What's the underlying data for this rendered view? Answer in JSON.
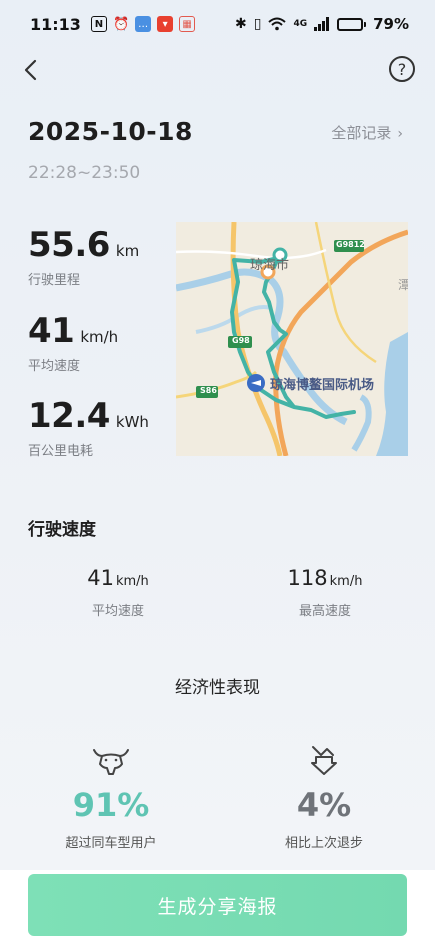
{
  "status_bar": {
    "time": "11:13",
    "network": "4G",
    "battery_percent": "79%",
    "battery_level": 0.79,
    "icons": [
      "nfc-icon",
      "alarm-icon",
      "chat-app-icon",
      "shopping-app-icon",
      "calendar-icon",
      "bluetooth-icon",
      "vibrate-icon",
      "wifi-icon",
      "signal-icon",
      "battery-icon"
    ]
  },
  "nav": {
    "back_icon": "chevron-left-icon",
    "help_icon": "?"
  },
  "trip": {
    "date": "2025-10-18",
    "time_range": "22:28~23:50",
    "all_records_label": "全部记录",
    "all_records_chevron": "›"
  },
  "stats": [
    {
      "value": "55.6",
      "unit": "km",
      "label": "行驶里程"
    },
    {
      "value": "41",
      "unit": "km/h",
      "label": "平均速度"
    },
    {
      "value": "12.4",
      "unit": "kWh",
      "label": "百公里电耗"
    }
  ],
  "map": {
    "labels": {
      "city": "琼海市",
      "airport": "琼海博鳌国际机场",
      "road_g9812": "G9812",
      "road_g98": "G98",
      "road_s86": "S86",
      "edge_char": "潭"
    },
    "colors": {
      "route": "#43b3a6",
      "highway": "#f2a65a",
      "road": "#f5d57a",
      "water": "#a9cfe8",
      "land": "#f1ece0"
    }
  },
  "speed_section": {
    "title": "行驶速度",
    "items": [
      {
        "value": "41",
        "unit": "km/h",
        "label": "平均速度"
      },
      {
        "value": "118",
        "unit": "km/h",
        "label": "最高速度"
      }
    ]
  },
  "economy": {
    "title": "经济性表现",
    "items": [
      {
        "icon": "bull-icon",
        "value": "91%",
        "label": "超过同车型用户",
        "color": "#5fc4b3"
      },
      {
        "icon": "trend-down-icon",
        "value": "4%",
        "label": "相比上次退步",
        "color": "#6f7379"
      }
    ]
  },
  "share_button": {
    "label": "生成分享海报"
  }
}
